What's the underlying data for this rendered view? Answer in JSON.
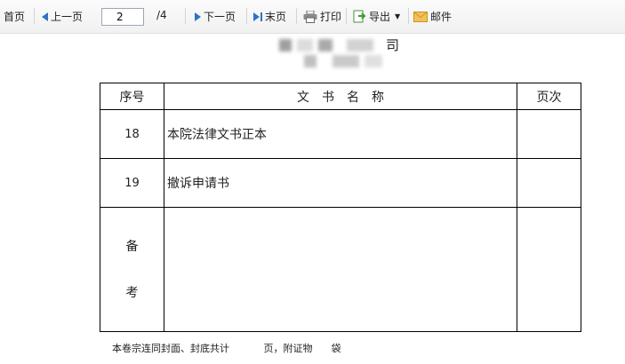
{
  "toolbar": {
    "first": "首页",
    "prev": "上一页",
    "page_value": "2",
    "page_total": "/4",
    "next": "下一页",
    "last": "末页",
    "print": "打印",
    "export": "导出",
    "mail": "邮件",
    "icons": {
      "prev": "triangle-left-icon",
      "next": "triangle-right-icon",
      "last": "skip-end-icon",
      "print": "printer-icon",
      "export": "export-icon",
      "mail": "envelope-icon"
    },
    "accent": "#2d74c4"
  },
  "document": {
    "title_partial": "司",
    "table": {
      "headers": [
        "序号",
        "文　书　名　称",
        "页次"
      ],
      "rows": [
        {
          "seq": "18",
          "name": "本院法律文书正本",
          "page": ""
        },
        {
          "seq": "19",
          "name": "撤诉申请书",
          "page": ""
        }
      ],
      "remark_label_1": "备",
      "remark_label_2": "考"
    },
    "footer_note": "本卷宗连同封面、封底共计           页，附证物      袋"
  }
}
